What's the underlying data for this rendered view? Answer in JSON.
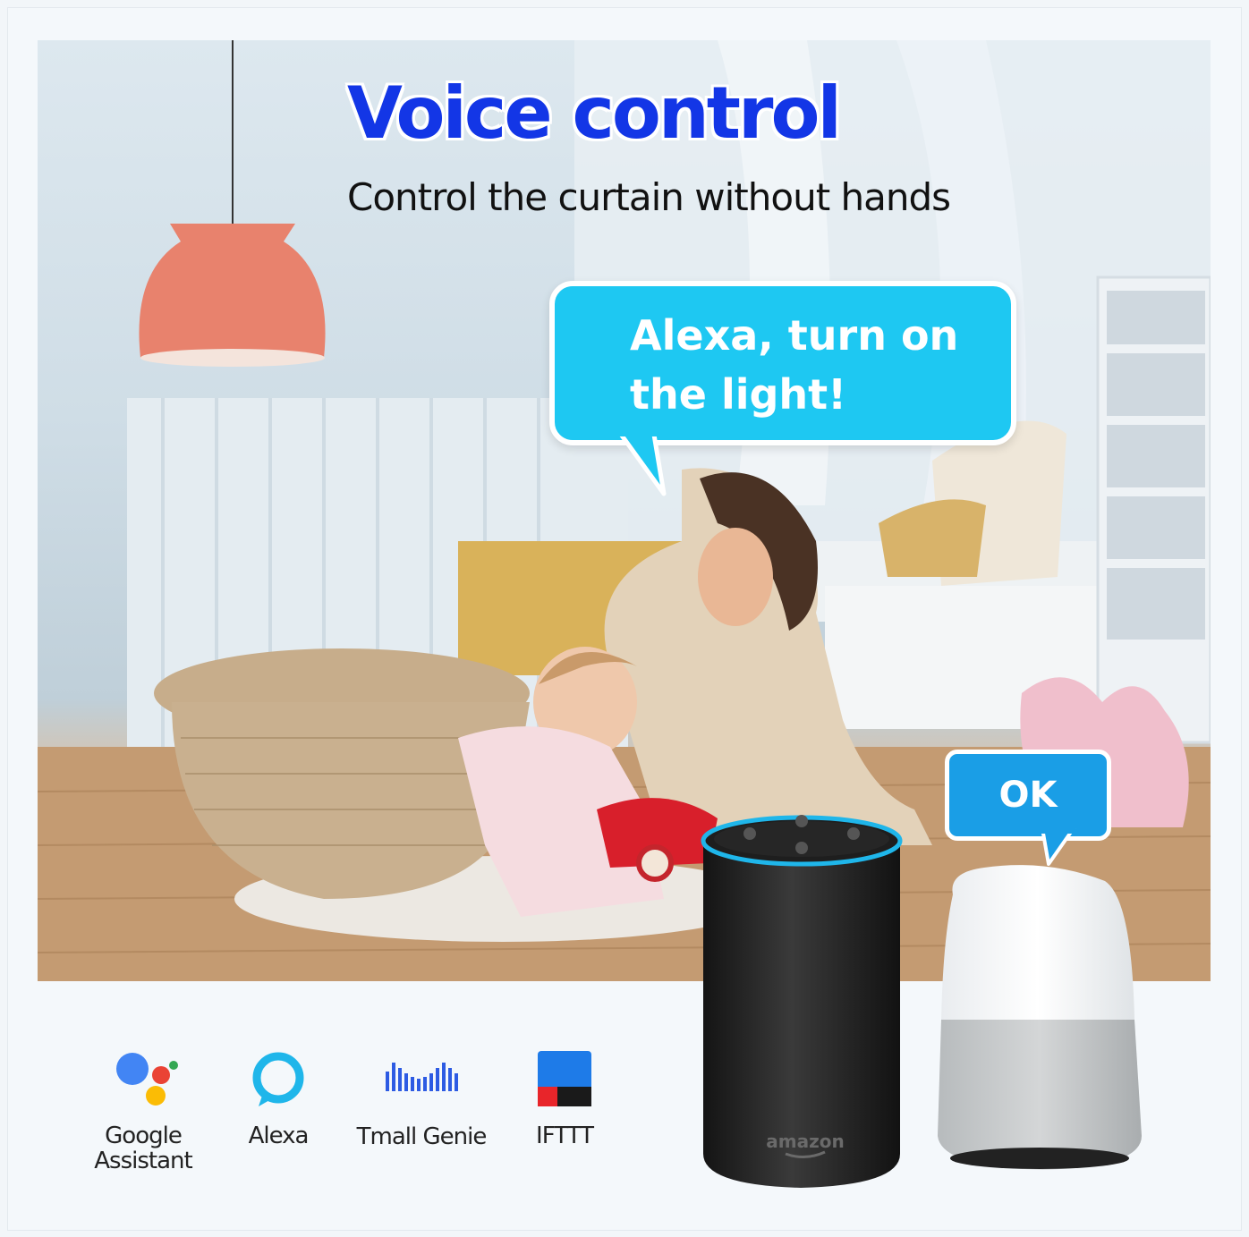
{
  "headline": {
    "title": "Voice control",
    "subtitle": "Control the curtain without hands"
  },
  "speech_bubble": {
    "text": "Alexa, turn on\nthe light!"
  },
  "reply_bubble": {
    "text": "OK"
  },
  "speaker": {
    "brand": "amazon"
  },
  "assistants": [
    {
      "label": "Google\nAssistant",
      "icon": "google-assistant-icon"
    },
    {
      "label": "Alexa",
      "icon": "alexa-icon"
    },
    {
      "label": "Tmall Genie",
      "icon": "tmall-genie-icon"
    },
    {
      "label": "IFTTT",
      "icon": "ifttt-icon"
    }
  ],
  "colors": {
    "title": "#1336e6",
    "bubble": "#1ec8f2",
    "ok_bubble": "#1a9ee6",
    "alexa_ring": "#1fb6ea"
  }
}
